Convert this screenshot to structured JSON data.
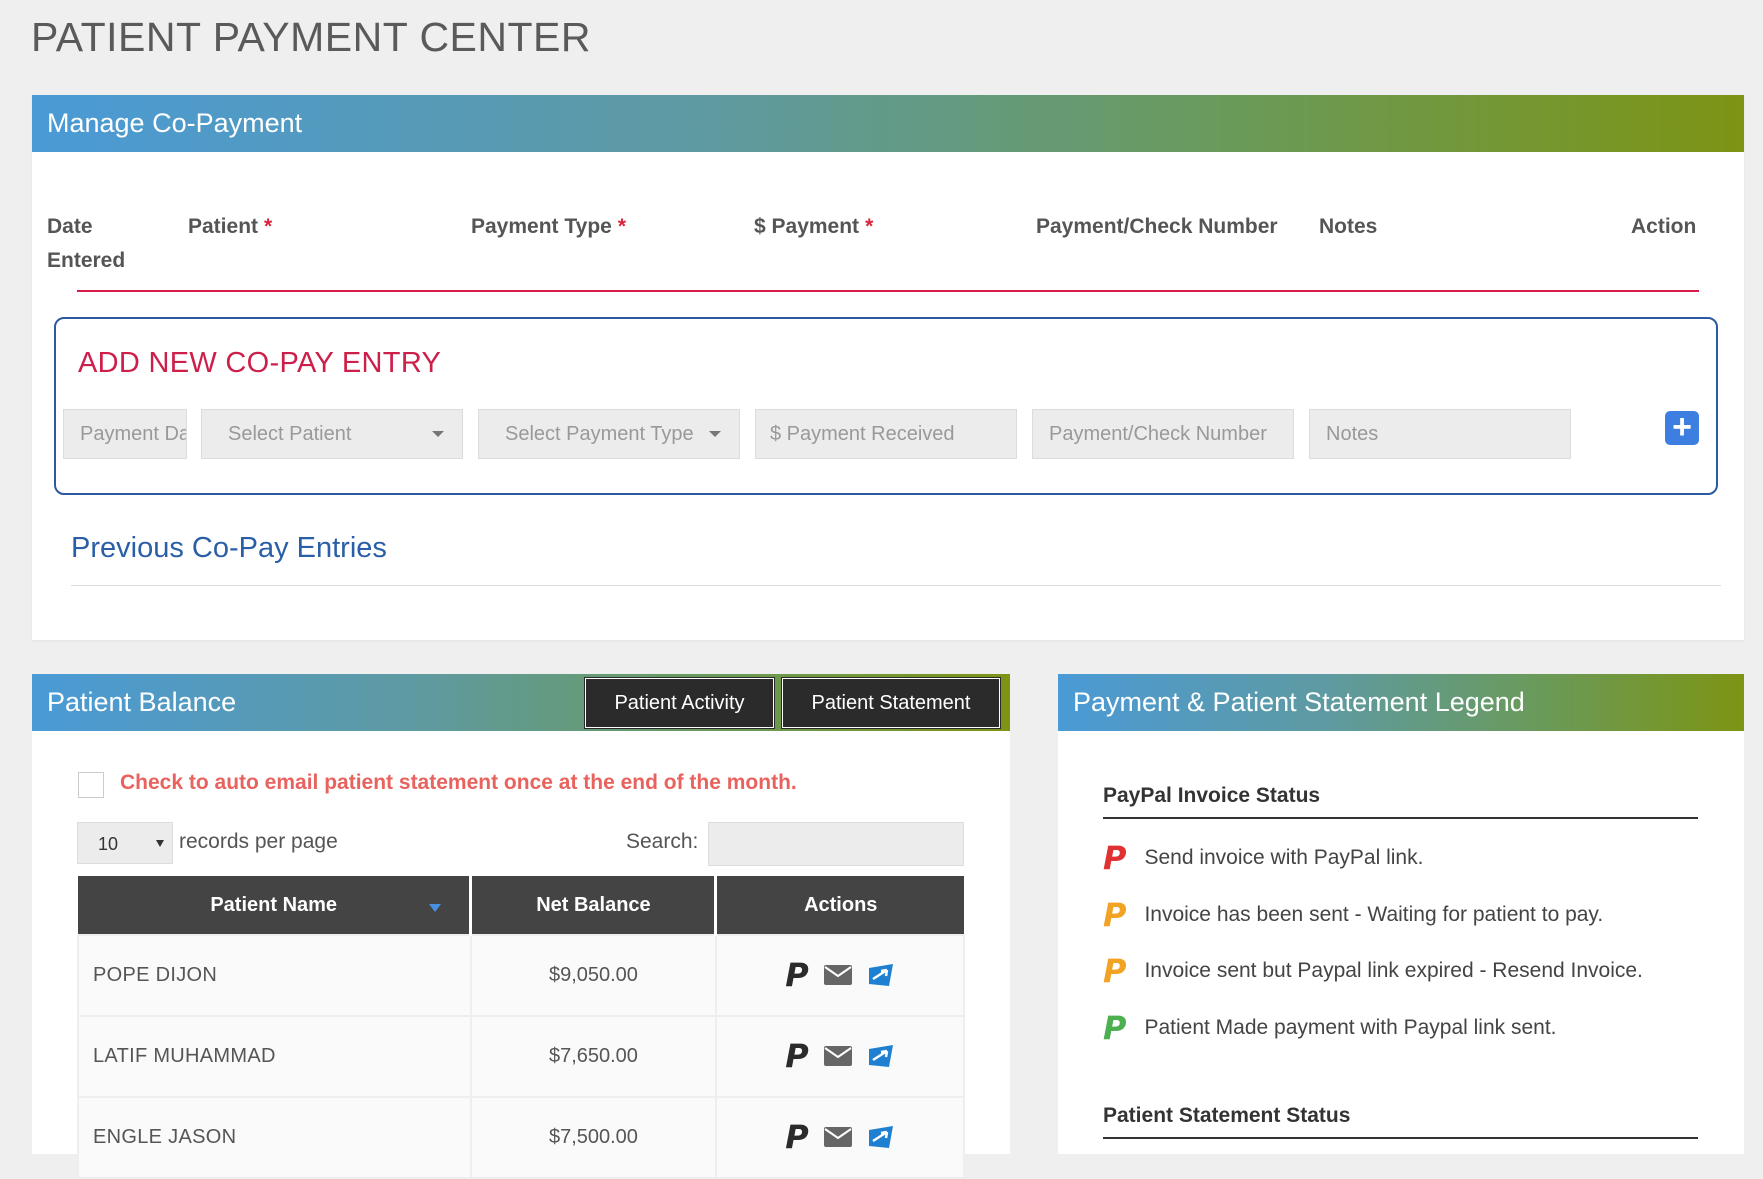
{
  "page": {
    "title": "PATIENT PAYMENT CENTER"
  },
  "manage": {
    "title": "Manage Co-Payment",
    "columns": {
      "date_line1": "Date",
      "date_line2": "Entered",
      "patient": "Patient",
      "payment_type": "Payment Type",
      "payment": "$ Payment",
      "check_number": "Payment/Check Number",
      "notes": "Notes",
      "action": "Action",
      "required_mark": "*"
    },
    "add_entry": {
      "title": "ADD NEW CO-PAY ENTRY",
      "date_placeholder": "Payment Da",
      "patient_select": "Select Patient",
      "payment_type_select": "Select Payment Type",
      "payment_placeholder": "$ Payment Received",
      "check_placeholder": "Payment/Check Number",
      "notes_placeholder": "Notes",
      "add_icon": "plus-square-icon"
    },
    "previous_title": "Previous Co-Pay Entries"
  },
  "balance": {
    "title": "Patient Balance",
    "activity_button": "Patient Activity",
    "statement_button": "Patient Statement",
    "auto_email_label": "Check to auto email patient statement once at the end of the month.",
    "records_value": "10",
    "records_label": "records per page",
    "search_label": "Search:",
    "columns": {
      "name": "Patient Name",
      "net": "Net Balance",
      "actions": "Actions"
    },
    "rows": [
      {
        "name": "POPE DIJON",
        "net": "$9,050.00"
      },
      {
        "name": "LATIF MUHAMMAD",
        "net": "$7,650.00"
      },
      {
        "name": "ENGLE JASON",
        "net": "$7,500.00"
      }
    ],
    "row_icons": [
      "paypal-icon",
      "envelope-icon",
      "send-statement-icon"
    ]
  },
  "legend": {
    "title": "Payment & Patient Statement Legend",
    "paypal_heading": "PayPal Invoice Status",
    "paypal_items": [
      {
        "text": "Send invoice with PayPal link.",
        "color": "#e03232"
      },
      {
        "text": "Invoice has been sent - Waiting for patient to pay.",
        "color": "#f2a324"
      },
      {
        "text": "Invoice sent but Paypal link expired - Resend Invoice.",
        "color": "#f2a324"
      },
      {
        "text": "Patient Made payment with Paypal link sent.",
        "color": "#4caf50"
      }
    ],
    "statement_heading": "Patient Statement Status"
  },
  "colors": {
    "accent_red": "#d81b4a",
    "link_blue": "#2a5fa8",
    "header_gradient_start": "#4a9ad6",
    "header_gradient_end": "#7d9414"
  }
}
